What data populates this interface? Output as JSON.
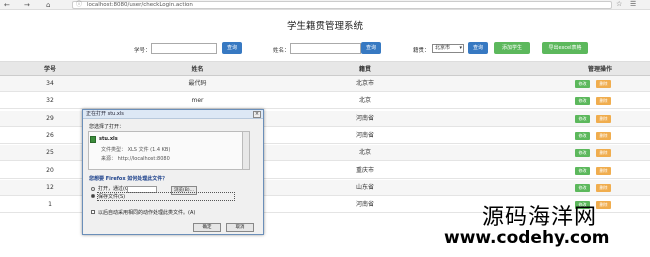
{
  "browser": {
    "nav_back": "←",
    "nav_forward": "→",
    "nav_home": "⌂",
    "url": "localhost:8080/user/checkLogin.action",
    "star_icon": "☆",
    "menu_icon": "☰"
  },
  "page_title": "学生籍贯管理系统",
  "search": {
    "sid_label": "学号：",
    "sid_value": "",
    "sid_button": "查询",
    "name_label": "姓名：",
    "name_value": "",
    "name_button": "查询",
    "origin_label": "籍贯：",
    "origin_selected": "北京市",
    "origin_button": "查询",
    "add_button": "添加学生",
    "export_button": "导出excel表格"
  },
  "colors": {
    "primary": "#3779c2",
    "success": "#5cb85c",
    "warning": "#f0ad4e"
  },
  "table": {
    "headers": [
      "学号",
      "姓名",
      "籍贯",
      "管理操作"
    ],
    "edit_label": "修改",
    "delete_label": "删除",
    "rows": [
      {
        "id": "34",
        "name": "最代码",
        "origin": "北京市"
      },
      {
        "id": "32",
        "name": "mer",
        "origin": "北京"
      },
      {
        "id": "29",
        "name": "",
        "origin": "河南省"
      },
      {
        "id": "26",
        "name": "",
        "origin": "河南省"
      },
      {
        "id": "25",
        "name": "",
        "origin": "北京"
      },
      {
        "id": "20",
        "name": "",
        "origin": "重庆市"
      },
      {
        "id": "12",
        "name": "",
        "origin": "山东省"
      },
      {
        "id": "1",
        "name": "",
        "origin": "河南省"
      }
    ]
  },
  "dialog": {
    "title": "正在打开 stu.xls",
    "close": "×",
    "chosen_text": "您选择了打开：",
    "filename": "stu.xls",
    "filetype": "文件类型： XLS 文件 (1.4 KB)",
    "source": "来源： http://localhost:8080",
    "question": "您想要 Firefox 如何处理此文件？",
    "open_with": "打开，通过(O)",
    "open_with_select": "",
    "browse": "浏览(B)...",
    "save_file": "保存文件(S)",
    "auto_check": "以后自动采用相同的动作处理此类文件。(A)",
    "ok": "确定",
    "cancel": "取消"
  },
  "watermark": {
    "line1": "源码海洋网",
    "line2": "www.codehy.com"
  }
}
